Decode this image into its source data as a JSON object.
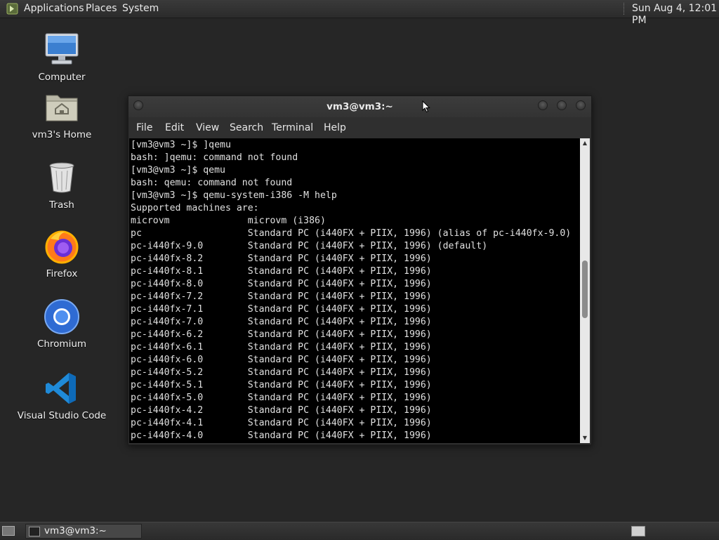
{
  "top_panel": {
    "menus": [
      "Applications",
      "Places",
      "System"
    ],
    "clock": "Sun Aug  4, 12:01 PM"
  },
  "desktop": {
    "icons": [
      {
        "label": "Computer",
        "icon": "computer-icon"
      },
      {
        "label": "vm3's Home",
        "icon": "home-folder-icon"
      },
      {
        "label": "Trash",
        "icon": "trash-icon"
      },
      {
        "label": "Firefox",
        "icon": "firefox-icon"
      },
      {
        "label": "Chromium",
        "icon": "chromium-icon"
      },
      {
        "label": "Visual Studio Code",
        "icon": "vscode-icon"
      }
    ]
  },
  "terminal": {
    "title": "vm3@vm3:~",
    "menu": [
      "File",
      "Edit",
      "View",
      "Search",
      "Terminal",
      "Help"
    ],
    "lines": [
      "[vm3@vm3 ~]$ ]qemu",
      "bash: ]qemu: command not found",
      "[vm3@vm3 ~]$ qemu",
      "bash: qemu: command not found",
      "[vm3@vm3 ~]$ qemu-system-i386 -M help",
      "Supported machines are:",
      "microvm              microvm (i386)",
      "pc                   Standard PC (i440FX + PIIX, 1996) (alias of pc-i440fx-9.0)",
      "pc-i440fx-9.0        Standard PC (i440FX + PIIX, 1996) (default)",
      "pc-i440fx-8.2        Standard PC (i440FX + PIIX, 1996)",
      "pc-i440fx-8.1        Standard PC (i440FX + PIIX, 1996)",
      "pc-i440fx-8.0        Standard PC (i440FX + PIIX, 1996)",
      "pc-i440fx-7.2        Standard PC (i440FX + PIIX, 1996)",
      "pc-i440fx-7.1        Standard PC (i440FX + PIIX, 1996)",
      "pc-i440fx-7.0        Standard PC (i440FX + PIIX, 1996)",
      "pc-i440fx-6.2        Standard PC (i440FX + PIIX, 1996)",
      "pc-i440fx-6.1        Standard PC (i440FX + PIIX, 1996)",
      "pc-i440fx-6.0        Standard PC (i440FX + PIIX, 1996)",
      "pc-i440fx-5.2        Standard PC (i440FX + PIIX, 1996)",
      "pc-i440fx-5.1        Standard PC (i440FX + PIIX, 1996)",
      "pc-i440fx-5.0        Standard PC (i440FX + PIIX, 1996)",
      "pc-i440fx-4.2        Standard PC (i440FX + PIIX, 1996)",
      "pc-i440fx-4.1        Standard PC (i440FX + PIIX, 1996)",
      "pc-i440fx-4.0        Standard PC (i440FX + PIIX, 1996)"
    ]
  },
  "taskbar": {
    "window_button": "vm3@vm3:~"
  },
  "colors": {
    "desktop_bg": "#262626",
    "terminal_bg": "#000000",
    "terminal_fg": "#e0e0e0"
  }
}
